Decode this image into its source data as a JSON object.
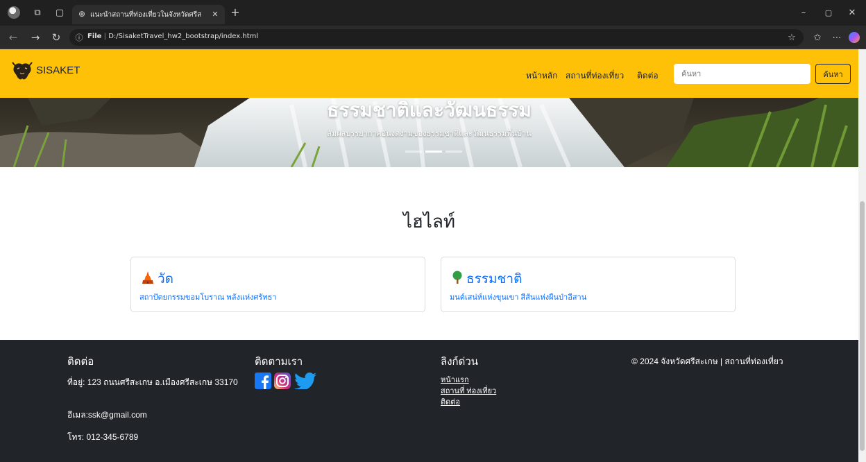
{
  "browser": {
    "tab_title": "แนะนำสถานที่ท่องเที่ยวในจังหวัดศรีสะเกษ",
    "address_prefix": "File",
    "address_url": "D:/SisaketTravel_hw2_bootstrap/index.html"
  },
  "navbar": {
    "brand": "SISAKET",
    "links": [
      "หน้าหลัก",
      "สถานที่ท่องเที่ยว",
      "ติดต่อ"
    ],
    "search_placeholder": "ค้นหา",
    "search_button": "ค้นหา",
    "accent": "#ffc107"
  },
  "hero": {
    "title": "ธรรมชาติและวัฒนธรรม",
    "subtitle": "สัมผัสบรรยากาศอันงดงามของธรรมชาติและวัฒนธรรมพื้นบ้าน",
    "active_slide_index": 1
  },
  "highlights": {
    "title": "ไฮไลท์",
    "cards": [
      {
        "icon": "temple-icon",
        "title": "วัด",
        "text": "สถาปัตยกรรมขอมโบราณ พลังแห่งศรัทธา"
      },
      {
        "icon": "tree-icon",
        "title": "ธรรมชาติ",
        "text": "มนต์เสน่ห์แห่งขุนเขา สีสันแห่งผืนป่าอีสาน"
      }
    ]
  },
  "footer": {
    "contact": {
      "heading": "ติดต่อ",
      "address": "ที่อยู่: 123 ถนนศรีสะเกษ อ.เมืองศรีสะเกษ 33170",
      "email": "อีเมล:ssk@gmail.com",
      "phone": "โทร: 012-345-6789"
    },
    "follow": {
      "heading": "ติดตามเรา",
      "icons": [
        "facebook-icon",
        "instagram-icon",
        "twitter-icon"
      ]
    },
    "quicklinks": {
      "heading": "ลิงก์ด่วน",
      "links": [
        "หน้าแรก",
        "สถานที่ ท่องเที่ยว",
        "ติดต่อ"
      ]
    },
    "copyright": "© 2024 จังหวัดศรีสะเกษ | สถานที่ท่องเที่ยว",
    "background": "#212529"
  }
}
